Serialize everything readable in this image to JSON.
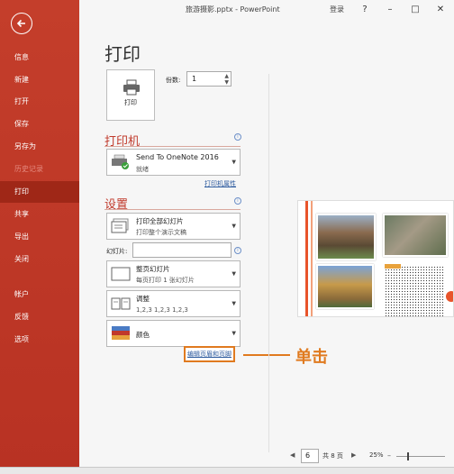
{
  "window": {
    "title": "旅游摄影.pptx - PowerPoint",
    "login": "登录",
    "help": "?",
    "minimize": "–",
    "restore": "□",
    "close": "✕"
  },
  "sidebar": {
    "items": [
      {
        "label": "信息"
      },
      {
        "label": "新建"
      },
      {
        "label": "打开"
      },
      {
        "label": "保存"
      },
      {
        "label": "另存为"
      },
      {
        "label": "历史记录"
      },
      {
        "label": "打印"
      },
      {
        "label": "共享"
      },
      {
        "label": "导出"
      },
      {
        "label": "关闭"
      },
      {
        "label": "帐户"
      },
      {
        "label": "反馈"
      },
      {
        "label": "选项"
      }
    ]
  },
  "print": {
    "title": "打印",
    "button_label": "打印",
    "copies_label": "份数:",
    "copies_value": "1"
  },
  "printer": {
    "heading": "打印机",
    "name": "Send To OneNote 2016",
    "status": "就绪",
    "properties_link": "打印机属性",
    "info": "i"
  },
  "settings": {
    "heading": "设置",
    "range_main": "打印全部幻灯片",
    "range_sub": "打印整个演示文稿",
    "slides_label": "幻灯片:",
    "layout_main": "整页幻灯片",
    "layout_sub": "每页打印 1 张幻灯片",
    "collate_main": "调整",
    "collate_sub": "1,2,3    1,2,3    1,2,3",
    "color_main": "颜色",
    "edit_header_footer": "编辑页眉和页脚"
  },
  "callout": {
    "text": "单击"
  },
  "preview_nav": {
    "page": "6",
    "total": "共 8 页",
    "zoom": "25%",
    "prev": "◀",
    "next": "▶"
  }
}
